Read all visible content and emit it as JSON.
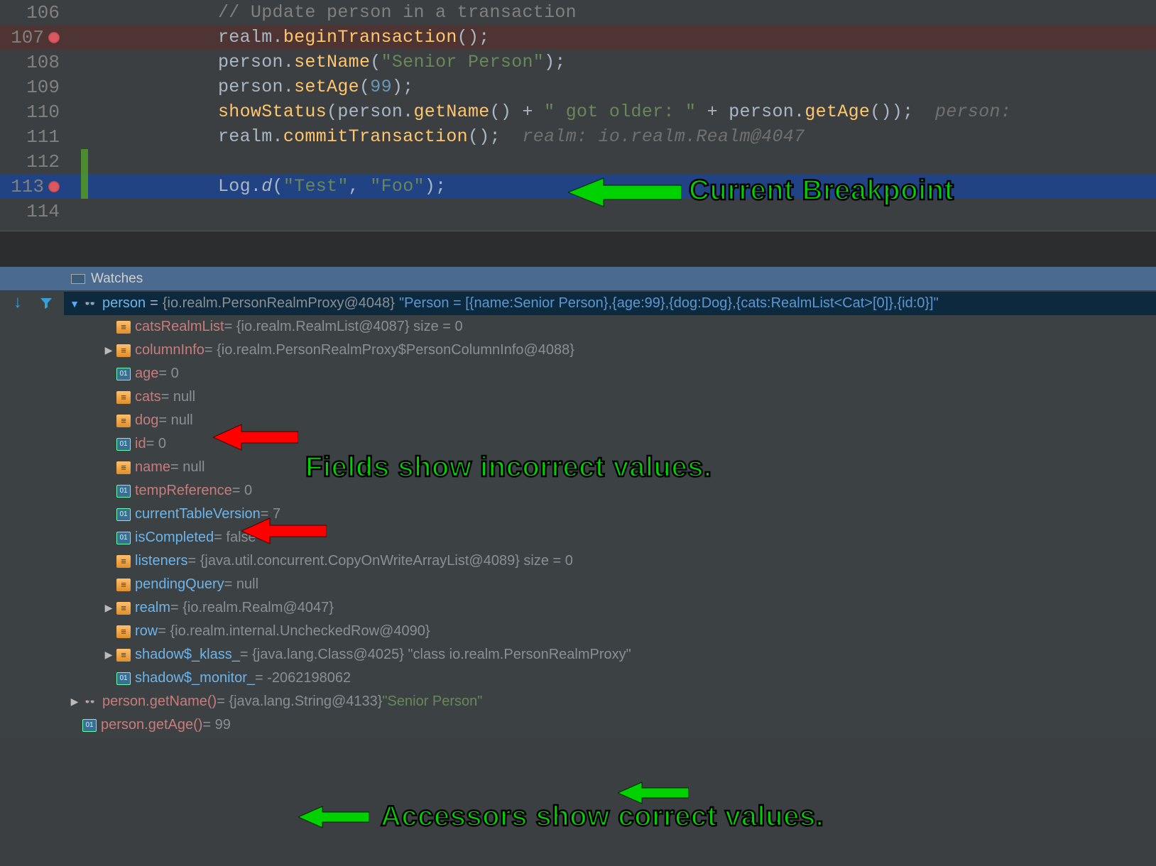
{
  "editor": {
    "lines": [
      {
        "num": "106",
        "cls": "",
        "tokens": [
          {
            "c": "c-comment",
            "t": "// Update person in a transaction"
          }
        ]
      },
      {
        "num": "107",
        "cls": "line-107",
        "bp": true,
        "tokens": [
          {
            "c": "c-ident",
            "t": "realm."
          },
          {
            "c": "c-method",
            "t": "beginTransaction"
          },
          {
            "c": "c-ident",
            "t": "();"
          }
        ]
      },
      {
        "num": "108",
        "cls": "",
        "tokens": [
          {
            "c": "c-ident",
            "t": "person."
          },
          {
            "c": "c-method",
            "t": "setName"
          },
          {
            "c": "c-ident",
            "t": "("
          },
          {
            "c": "c-str",
            "t": "\"Senior Person\""
          },
          {
            "c": "c-ident",
            "t": ");"
          }
        ]
      },
      {
        "num": "109",
        "cls": "",
        "tokens": [
          {
            "c": "c-ident",
            "t": "person."
          },
          {
            "c": "c-method",
            "t": "setAge"
          },
          {
            "c": "c-ident",
            "t": "("
          },
          {
            "c": "c-num",
            "t": "99"
          },
          {
            "c": "c-ident",
            "t": ");"
          }
        ]
      },
      {
        "num": "110",
        "cls": "",
        "tokens": [
          {
            "c": "c-method",
            "t": "showStatus"
          },
          {
            "c": "c-ident",
            "t": "(person."
          },
          {
            "c": "c-method",
            "t": "getName"
          },
          {
            "c": "c-ident",
            "t": "() + "
          },
          {
            "c": "c-str",
            "t": "\" got older: \""
          },
          {
            "c": "c-ident",
            "t": " + person."
          },
          {
            "c": "c-method",
            "t": "getAge"
          },
          {
            "c": "c-ident",
            "t": "());  "
          },
          {
            "c": "c-dim",
            "t": "person:"
          }
        ]
      },
      {
        "num": "111",
        "cls": "",
        "tokens": [
          {
            "c": "c-ident",
            "t": "realm."
          },
          {
            "c": "c-method",
            "t": "commitTransaction"
          },
          {
            "c": "c-ident",
            "t": "();  "
          },
          {
            "c": "c-dim",
            "t": "realm: io.realm.Realm@4047"
          }
        ]
      },
      {
        "num": "112",
        "cls": "",
        "tokens": []
      },
      {
        "num": "113",
        "cls": "line-113",
        "bp": true,
        "tokens": [
          {
            "c": "c-ident",
            "t": "Log."
          },
          {
            "c": "c-static",
            "t": "d"
          },
          {
            "c": "c-ident",
            "t": "("
          },
          {
            "c": "c-str",
            "t": "\"Test\""
          },
          {
            "c": "c-ident",
            "t": ", "
          },
          {
            "c": "c-str",
            "t": "\"Foo\""
          },
          {
            "c": "c-ident",
            "t": ");"
          }
        ]
      },
      {
        "num": "114",
        "cls": "",
        "tokens": []
      }
    ]
  },
  "watches": {
    "title": "Watches",
    "root": {
      "name": "person",
      "eq": "=",
      "type": "{io.realm.PersonRealmProxy@4048}",
      "summary": "\"Person = [{name:Senior Person},{age:99},{dog:Dog},{cats:RealmList<Cat>[0]},{id:0}]\""
    },
    "fields": [
      {
        "icon": "obj",
        "arrow": false,
        "name": "catsRealmList",
        "rest": " = {io.realm.RealmList@4087}  size = 0"
      },
      {
        "icon": "obj",
        "arrow": true,
        "name": "columnInfo",
        "rest": " = {io.realm.PersonRealmProxy$PersonColumnInfo@4088}"
      },
      {
        "icon": "prim",
        "arrow": false,
        "name": "age",
        "rest": " = 0",
        "redArrow": true
      },
      {
        "icon": "obj",
        "arrow": false,
        "name": "cats",
        "rest": " = null"
      },
      {
        "icon": "obj",
        "arrow": false,
        "name": "dog",
        "rest": " = null"
      },
      {
        "icon": "prim",
        "arrow": false,
        "name": "id",
        "rest": " = 0"
      },
      {
        "icon": "obj",
        "arrow": false,
        "name": "name",
        "rest": " = null",
        "redArrow": true
      },
      {
        "icon": "prim",
        "arrow": false,
        "name": "tempReference",
        "rest": " = 0"
      },
      {
        "icon": "prim",
        "arrow": false,
        "name": "currentTableVersion",
        "blue": true,
        "rest": " = 7"
      },
      {
        "icon": "prim",
        "arrow": false,
        "name": "isCompleted",
        "blue": true,
        "rest": " = false"
      },
      {
        "icon": "obj",
        "arrow": false,
        "name": "listeners",
        "blue": true,
        "rest": " = {java.util.concurrent.CopyOnWriteArrayList@4089}  size = 0"
      },
      {
        "icon": "obj",
        "arrow": false,
        "name": "pendingQuery",
        "blue": true,
        "rest": " = null"
      },
      {
        "icon": "obj",
        "arrow": true,
        "name": "realm",
        "blue": true,
        "rest": " = {io.realm.Realm@4047}"
      },
      {
        "icon": "obj",
        "arrow": false,
        "name": "row",
        "blue": true,
        "rest": " = {io.realm.internal.UncheckedRow@4090}"
      },
      {
        "icon": "obj",
        "arrow": true,
        "name": "shadow$_klass_",
        "blue": true,
        "rest": " = {java.lang.Class@4025} \"class io.realm.PersonRealmProxy\""
      },
      {
        "icon": "prim",
        "arrow": false,
        "name": "shadow$_monitor_",
        "blue": true,
        "rest": " = -2062198062"
      }
    ],
    "accessors": [
      {
        "icon": "watch",
        "arrow": true,
        "name": "person.getName()",
        "rest": " = {java.lang.String@4133} ",
        "strval": "\"Senior Person\"",
        "greenArrow": true
      },
      {
        "icon": "prim",
        "arrow": false,
        "name": "person.getAge()",
        "rest": " = 99",
        "greenArrow": true
      }
    ]
  },
  "annotations": {
    "a1": "Current Breakpoint",
    "a2": "Fields show incorrect values.",
    "a3": "Accessors show correct values."
  }
}
